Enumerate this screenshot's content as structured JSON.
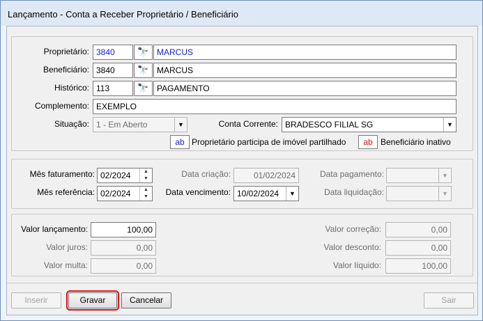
{
  "window": {
    "title": "Lançamento - Conta a Receber Proprietário / Beneficiário"
  },
  "section1": {
    "proprietario": {
      "label": "Proprietário:",
      "code": "3840",
      "name": "MARCUS"
    },
    "beneficiario": {
      "label": "Beneficiário:",
      "code": "3840",
      "name": "MARCUS"
    },
    "historico": {
      "label": "Histórico:",
      "code": "113",
      "name": "PAGAMENTO"
    },
    "complemento": {
      "label": "Complemento:",
      "value": "EXEMPLO"
    },
    "situacao": {
      "label": "Situação:",
      "value": "1 - Em Aberto"
    },
    "conta_corrente": {
      "label": "Conta Corrente:",
      "value": "BRADESCO FILIAL SG"
    },
    "legend": {
      "badge": "ab",
      "shared_text": "Proprietário participa de imóvel partilhado",
      "inactive_text": "Beneficiário inativo",
      "shared_color": "#1a1ac8",
      "inactive_color": "#d01010"
    }
  },
  "section2": {
    "mes_faturamento": {
      "label": "Mês faturamento:",
      "value": "02/2024"
    },
    "mes_referencia": {
      "label": "Mês referência:",
      "value": "02/2024"
    },
    "data_criacao": {
      "label": "Data criação:",
      "value": "01/02/2024"
    },
    "data_vencimento": {
      "label": "Data vencimento:",
      "value": "10/02/2024"
    },
    "data_pagamento": {
      "label": "Data pagamento:",
      "value": ""
    },
    "data_liquidacao": {
      "label": "Data liquidação:",
      "value": ""
    }
  },
  "section3": {
    "valor_lancamento": {
      "label": "Valor lançamento:",
      "value": "100,00"
    },
    "valor_juros": {
      "label": "Valor juros:",
      "value": "0,00"
    },
    "valor_multa": {
      "label": "Valor multa:",
      "value": "0,00"
    },
    "valor_correcao": {
      "label": "Valor correção:",
      "value": "0,00"
    },
    "valor_desconto": {
      "label": "Valor desconto:",
      "value": "0,00"
    },
    "valor_liquido": {
      "label": "Valor líquido:",
      "value": "100,00"
    }
  },
  "buttons": {
    "inserir": "Inserir",
    "gravar": "Gravar",
    "cancelar": "Cancelar",
    "sair": "Sair"
  },
  "icons": {
    "find": "binoculars-icon",
    "dropdown": "chevron-down-icon",
    "spin_up": "spin-up-icon",
    "spin_down": "spin-down-icon"
  }
}
